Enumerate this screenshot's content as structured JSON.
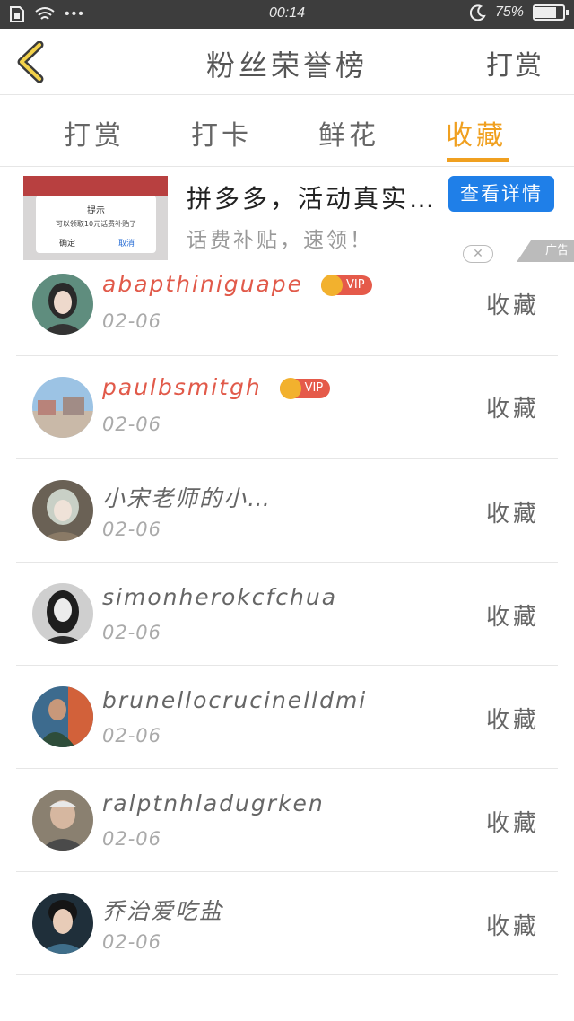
{
  "status_bar": {
    "time": "00:14",
    "battery": "75%",
    "battery_level": 0.75
  },
  "header": {
    "title": "粉丝荣誉榜",
    "action_label": "打赏"
  },
  "tabs": [
    {
      "label": "打赏",
      "active": false
    },
    {
      "label": "打卡",
      "active": false
    },
    {
      "label": "鲜花",
      "active": false
    },
    {
      "label": "收藏",
      "active": true
    }
  ],
  "ad": {
    "title": "拼多多，活动真实…",
    "subtitle": "话费补贴，速领！",
    "button_label": "查看详情",
    "badge": "广告",
    "thumb": {
      "dialog_title": "提示",
      "dialog_message": "可以领取10元话费补贴了",
      "confirm": "确定",
      "cancel": "取消"
    }
  },
  "fans": [
    {
      "name": "abapthiniguape",
      "date": "02-06",
      "vip": true,
      "vip_label": "VIP",
      "action": "收藏"
    },
    {
      "name": "paulbsmitgh",
      "date": "02-06",
      "vip": true,
      "vip_label": "VIP",
      "action": "收藏"
    },
    {
      "name": "小宋老师的小…",
      "date": "02-06",
      "vip": false,
      "action": "收藏"
    },
    {
      "name": "simonherokcfchua",
      "date": "02-06",
      "vip": false,
      "action": "收藏"
    },
    {
      "name": "brunellocrucinelldmi",
      "date": "02-06",
      "vip": false,
      "action": "收藏"
    },
    {
      "name": "ralptnhladugrken",
      "date": "02-06",
      "vip": false,
      "action": "收藏"
    },
    {
      "name": "乔治爱吃盐",
      "date": "02-06",
      "vip": false,
      "action": "收藏"
    }
  ],
  "colors": {
    "accent": "#f0a020",
    "vip_name": "#e15a4a",
    "ad_button": "#1f7fe8",
    "status_bar": "#3d3d3d"
  }
}
